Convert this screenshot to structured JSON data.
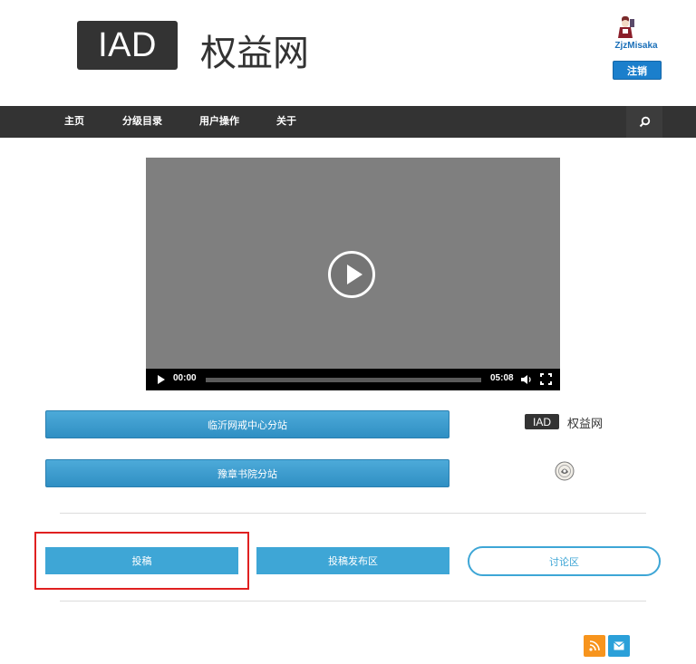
{
  "header": {
    "logo_badge": "IAD",
    "logo_text": "权益网"
  },
  "user": {
    "name": "ZjzMisaka",
    "logout_label": "注销"
  },
  "nav": {
    "items": [
      {
        "label": "主页"
      },
      {
        "label": "分级目录"
      },
      {
        "label": "用户操作"
      },
      {
        "label": "关于"
      }
    ],
    "search_icon": "search-icon"
  },
  "video": {
    "current_time": "00:00",
    "duration": "05:08",
    "progress": 0
  },
  "links": {
    "branch1_label": "临沂网戒中心分站",
    "branch2_label": "豫章书院分站",
    "side_logo_badge": "IAD",
    "side_logo_text": "权益网"
  },
  "actions": {
    "submit_label": "投稿",
    "publish_label": "投稿发布区",
    "discuss_label": "讨论区"
  },
  "colors": {
    "nav_bg": "#333333",
    "accent_blue": "#3ea6d6",
    "highlight_red": "#e02020",
    "rss_orange": "#f7941d"
  }
}
